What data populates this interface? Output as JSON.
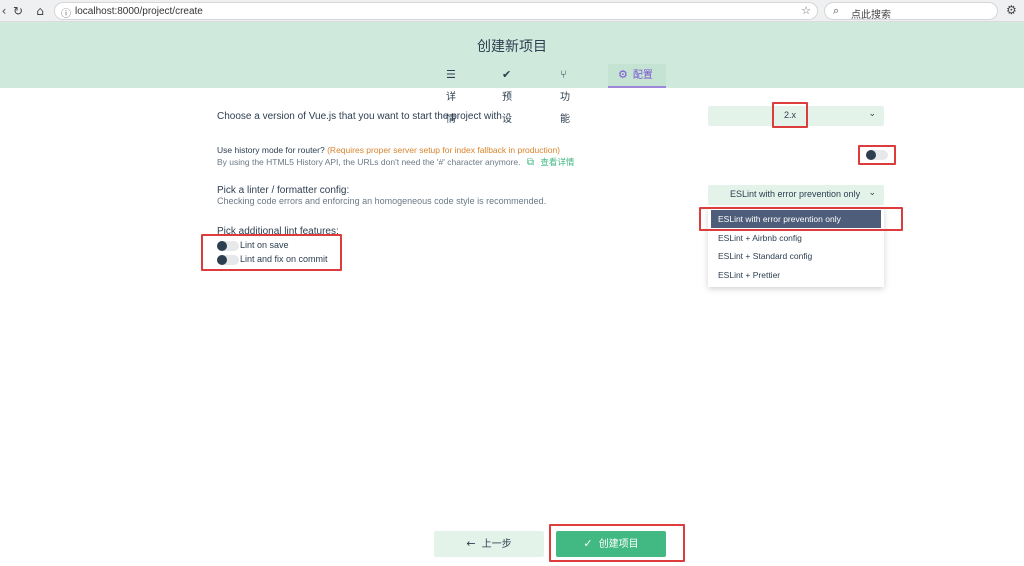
{
  "browser": {
    "url": "localhost:8000/project/create",
    "search_text": "点此搜索",
    "icons": {
      "back": "back-arrow-icon",
      "reload": "reload-icon",
      "home": "home-icon",
      "info": "info-icon",
      "star": "star-icon",
      "search": "search-icon",
      "extension": "extension-icon"
    }
  },
  "header": {
    "title": "创建新项目",
    "tabs": [
      {
        "label": "详情",
        "icon": "list-icon"
      },
      {
        "label": "预设",
        "icon": "check-circle-icon"
      },
      {
        "label": "功能",
        "icon": "fork-icon"
      },
      {
        "label": "配置",
        "icon": "settings-icon",
        "active": true
      }
    ]
  },
  "config": {
    "vue_version": {
      "label": "Choose a version of Vue.js that you want to start the project with",
      "value": "2.x"
    },
    "history_mode": {
      "label": "Use history mode for router?",
      "note": "(Requires proper server setup for index fallback in production)",
      "desc": "By using the HTML5 History API, the URLs don't need the '#' character anymore.",
      "link": "查看详情",
      "enabled": false
    },
    "linter": {
      "label": "Pick a linter / formatter config:",
      "desc": "Checking code errors and enforcing an homogeneous code style is recommended.",
      "selected": "ESLint with error prevention only",
      "options": [
        "ESLint with error prevention only",
        "ESLint + Airbnb config",
        "ESLint + Standard config",
        "ESLint + Prettier"
      ]
    },
    "lint_features": {
      "label": "Pick additional lint features:",
      "items": [
        {
          "label": "Lint on save",
          "enabled": false
        },
        {
          "label": "Lint and fix on commit",
          "enabled": false
        }
      ]
    }
  },
  "footer": {
    "prev_label": "上一步",
    "create_label": "创建项目"
  }
}
